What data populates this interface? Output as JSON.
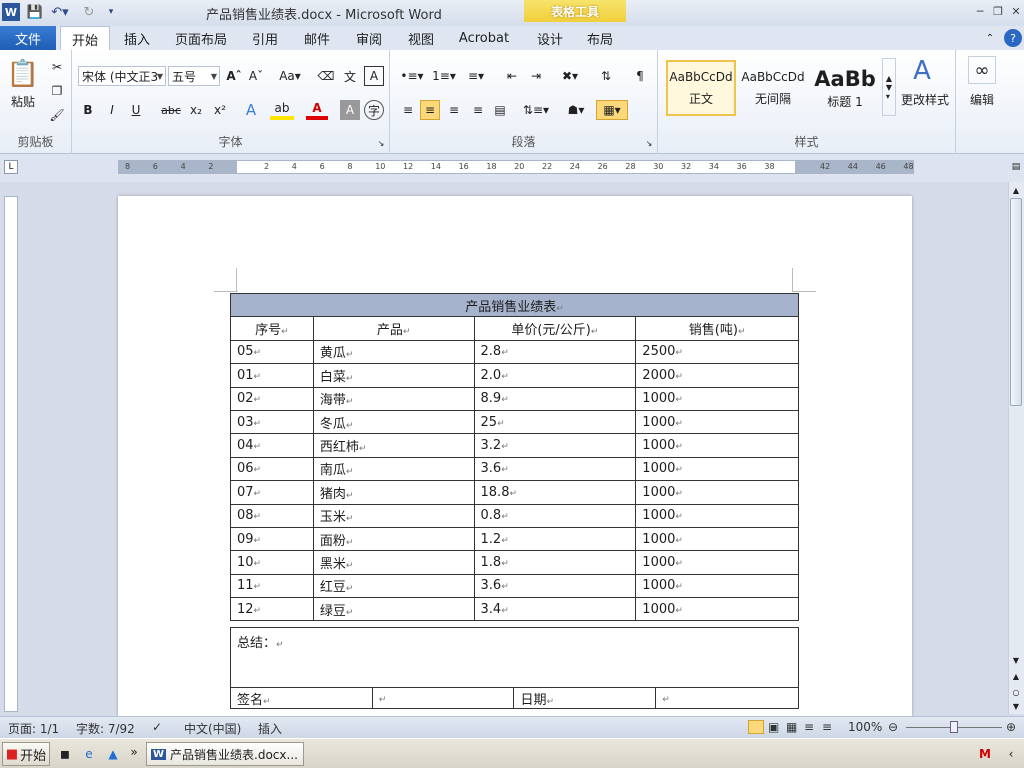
{
  "window": {
    "title": "产品销售业绩表.docx - Microsoft Word",
    "context_tab_group": "表格工具"
  },
  "tabs": {
    "file": "文件",
    "home": "开始",
    "insert": "插入",
    "page_layout": "页面布局",
    "references": "引用",
    "mailings": "邮件",
    "review": "审阅",
    "view": "视图",
    "acrobat": "Acrobat",
    "design": "设计",
    "layout": "布局"
  },
  "ribbon": {
    "clipboard": {
      "label": "剪贴板",
      "paste": "粘贴"
    },
    "font": {
      "label": "字体",
      "font_name": "宋体 (中文正3",
      "font_size": "五号",
      "bold": "B",
      "italic": "I",
      "underline": "U",
      "strike": "abc",
      "sub": "x₂",
      "sup": "x²"
    },
    "paragraph": {
      "label": "段落"
    },
    "styles": {
      "label": "样式",
      "items": [
        {
          "preview": "AaBbCcDd",
          "name": "正文"
        },
        {
          "preview": "AaBbCcDd",
          "name": "无间隔"
        },
        {
          "preview": "AaBb",
          "name": "标题 1"
        }
      ],
      "change_styles": "更改样式"
    },
    "editing": {
      "label": "编辑"
    }
  },
  "ruler": {
    "ticks": [
      "8",
      "6",
      "4",
      "2",
      "",
      "2",
      "4",
      "6",
      "8",
      "10",
      "12",
      "14",
      "16",
      "18",
      "20",
      "22",
      "24",
      "26",
      "28",
      "30",
      "32",
      "34",
      "36",
      "38",
      "",
      "42",
      "44",
      "46",
      "48"
    ]
  },
  "table": {
    "title": "产品销售业绩表",
    "headers": [
      "序号",
      "产品",
      "单价(元/公斤)",
      "销售(吨)"
    ],
    "rows": [
      [
        "05",
        "黄瓜",
        "2.8",
        "2500"
      ],
      [
        "01",
        "白菜",
        "2.0",
        "2000"
      ],
      [
        "02",
        "海带",
        "8.9",
        "1000"
      ],
      [
        "03",
        "冬瓜",
        "25",
        "1000"
      ],
      [
        "04",
        "西红柿",
        "3.2",
        "1000"
      ],
      [
        "06",
        "南瓜",
        "3.6",
        "1000"
      ],
      [
        "07",
        "猪肉",
        "18.8",
        "1000"
      ],
      [
        "08",
        "玉米",
        "0.8",
        "1000"
      ],
      [
        "09",
        "面粉",
        "1.2",
        "1000"
      ],
      [
        "10",
        "黑米",
        "1.8",
        "1000"
      ],
      [
        "11",
        "红豆",
        "3.6",
        "1000"
      ],
      [
        "12",
        "绿豆",
        "3.4",
        "1000"
      ]
    ],
    "summary_label": "总结：",
    "signature_label": "签名",
    "date_label": "日期"
  },
  "statusbar": {
    "page": "页面: 1/1",
    "words": "字数: 7/92",
    "language": "中文(中国)",
    "mode": "插入",
    "zoom": "100%"
  },
  "taskbar": {
    "start": "开始",
    "word_task": "产品销售业绩表.docx..."
  },
  "colors": {
    "file_tab": "#1e5eb4",
    "table_title_bg": "#a6b3cd",
    "context_tab": "#f1cf3a"
  }
}
